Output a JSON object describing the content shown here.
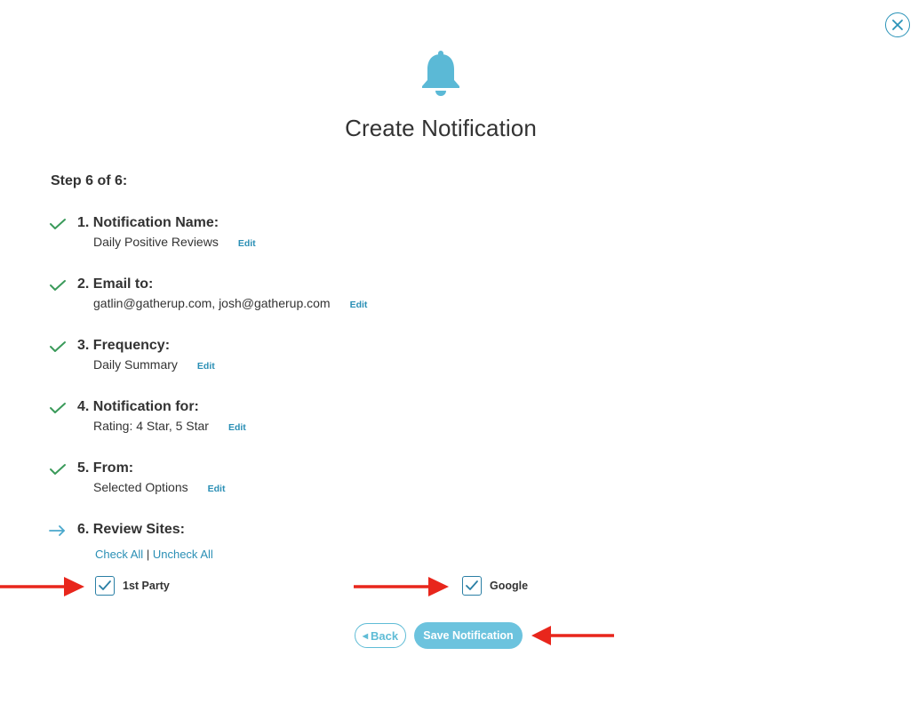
{
  "dialog": {
    "title": "Create Notification",
    "step_counter": "Step 6 of 6:",
    "icons": {
      "header": "bell-icon",
      "close": "close-icon",
      "completed": "checkmark-icon",
      "current": "arrow-right-icon"
    },
    "colors": {
      "accent": "#2a8fb5",
      "bell": "#5bb9d6",
      "check": "#3a9a5a",
      "save_button": "#6cc3de",
      "annotation_arrow": "#e8261c"
    }
  },
  "steps": [
    {
      "heading": "1. Notification Name:",
      "detail": "Daily Positive Reviews",
      "edit_label": "Edit",
      "status": "completed"
    },
    {
      "heading": "2. Email to:",
      "detail": "gatlin@gatherup.com, josh@gatherup.com",
      "edit_label": "Edit",
      "status": "completed"
    },
    {
      "heading": "3. Frequency:",
      "detail": "Daily Summary",
      "edit_label": "Edit",
      "status": "completed"
    },
    {
      "heading": "4. Notification for:",
      "detail": "Rating: 4 Star, 5 Star",
      "edit_label": "Edit",
      "status": "completed"
    },
    {
      "heading": "5. From:",
      "detail": "Selected Options",
      "edit_label": "Edit",
      "status": "completed"
    },
    {
      "heading": "6. Review Sites:",
      "status": "current"
    }
  ],
  "review_sites": {
    "check_all_label": "Check All",
    "separator": "|",
    "uncheck_all_label": "Uncheck All",
    "options": [
      {
        "label": "1st Party",
        "checked": true
      },
      {
        "label": "Google",
        "checked": true
      }
    ]
  },
  "actions": {
    "back_label": "Back",
    "save_label": "Save Notification"
  }
}
